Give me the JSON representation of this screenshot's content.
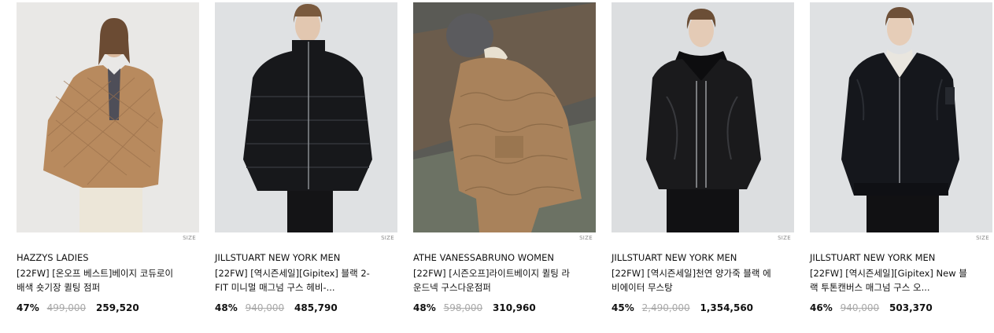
{
  "size_label": "SIZE",
  "products": [
    {
      "brand": "HAZZYS LADIES",
      "name": "[22FW] [온오프 베스트]베이지 코듀로이 배색 숏기장 퀼팅 점퍼",
      "discount": "47%",
      "original_price": "499,000",
      "sale_price": "259,520",
      "image": "woman-in-beige-quilted-jacket",
      "jacket_color": "#b88a5e",
      "background_color": "#e9e8e6"
    },
    {
      "brand": "JILLSTUART NEW YORK MEN",
      "name": "[22FW] [역시즌세일][Gipitex] 블랙 2-FIT 미니멀 매그넘 구스 헤비-...",
      "discount": "48%",
      "original_price": "940,000",
      "sale_price": "485,790",
      "image": "man-in-black-puffer-jacket",
      "jacket_color": "#17181b",
      "background_color": "#dfe1e3"
    },
    {
      "brand": "ATHE VANESSABRUNO WOMEN",
      "name": "[22FW] [시즌오프]라이트베이지 퀼팅 라운드넥 구스다운점퍼",
      "discount": "48%",
      "original_price": "598,000",
      "sale_price": "310,960",
      "image": "person-in-quilted-down-jacket-outdoors",
      "jacket_color": "#a9825b",
      "background_color": "#5a5a55"
    },
    {
      "brand": "JILLSTUART NEW YORK MEN",
      "name": "[22FW] [역시즌세일]천연 양가죽 블랙 에비에이터 무스탕",
      "discount": "45%",
      "original_price": "2,490,000",
      "sale_price": "1,354,560",
      "image": "man-in-black-leather-aviator-jacket",
      "jacket_color": "#1a1a1c",
      "background_color": "#dcdee0"
    },
    {
      "brand": "JILLSTUART NEW YORK MEN",
      "name": "[22FW] [역시즌세일][Gipitex] New 블랙 투톤캔버스 매그넘 구스 오...",
      "discount": "46%",
      "original_price": "940,000",
      "sale_price": "503,370",
      "image": "man-in-black-hooded-bomber-jacket",
      "jacket_color": "#15171c",
      "background_color": "#dfe1e3"
    }
  ]
}
